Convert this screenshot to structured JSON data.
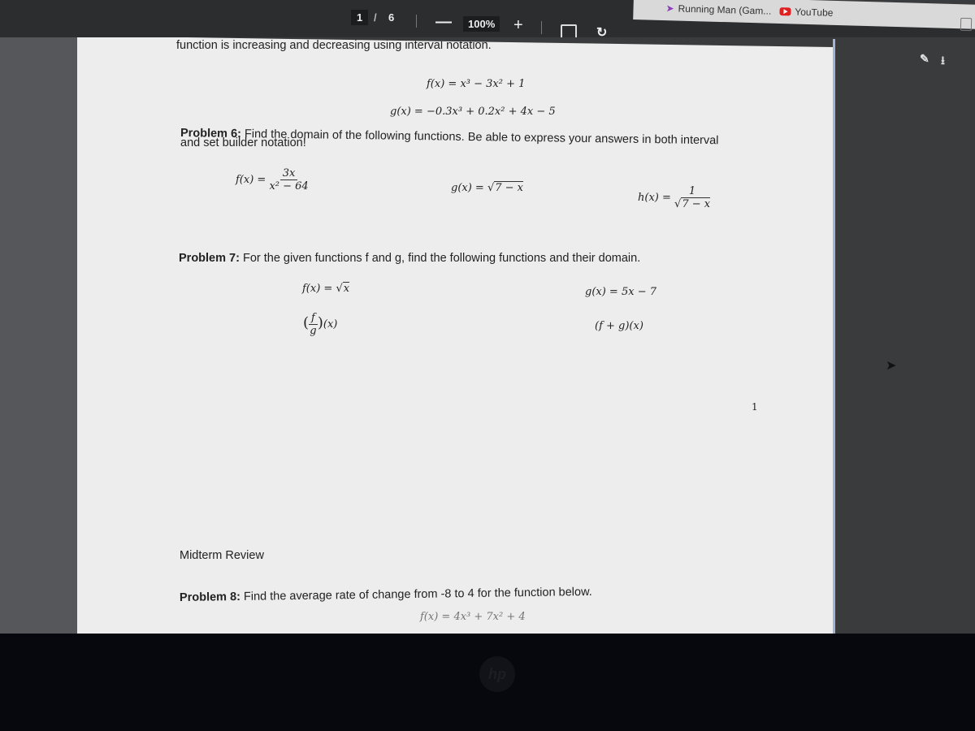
{
  "browser": {
    "bookmarks": [
      {
        "icon": "running-man-icon",
        "label": "Running Man (Gam..."
      },
      {
        "icon": "youtube-icon",
        "label": "YouTube"
      }
    ],
    "more_label": "»"
  },
  "viewer": {
    "current_page": "1",
    "page_separator": "/",
    "total_pages": "6",
    "zoom_out_label": "—",
    "zoom_level": "100%",
    "zoom_in_label": "+",
    "fit_icon": "fit-page-icon",
    "rotate_icon": "rotate-icon",
    "pen_label": "✎",
    "download_label": "⭳"
  },
  "page1": {
    "intro_line": "function is increasing and decreasing using interval notation.",
    "p5_f": "f(x) = x³ − 3x² + 1",
    "p5_g": "g(x) = −0.3x³ + 0.2x² + 4x − 5",
    "p6_label": "Problem 6:",
    "p6_text1": " Find the domain of the following functions.  Be able to express your answers in both interval",
    "p6_text2": "and set builder notation!",
    "p6_f_lhs": "f(x) =",
    "p6_f_num": "3x",
    "p6_f_den": "x² − 64",
    "p6_g_lhs": "g(x) = √",
    "p6_g_rad": "7 − x",
    "p6_h_lhs": "h(x) =",
    "p6_h_num": "1",
    "p6_h_den_root": "√",
    "p6_h_den_rad": "7 − x",
    "p7_label": "Problem 7:",
    "p7_text": " For the given functions f and g, find the following functions and their domain.",
    "p7_f_lhs": "f(x) = √",
    "p7_f_rad": "x",
    "p7_g": "g(x) = 5x − 7",
    "p7_q_num": "f",
    "p7_q_den": "g",
    "p7_q_suffix": "(x)",
    "p7_sum": "(f + g)(x)",
    "page_number": "1"
  },
  "page2": {
    "header": "Midterm Review",
    "p8_label": "Problem 8:",
    "p8_text": " Find the average rate of change from -8 to 4 for the function below.",
    "p8_func": "f(x) = 4x³ + 7x² + 4"
  },
  "device": {
    "logo": "hp"
  }
}
